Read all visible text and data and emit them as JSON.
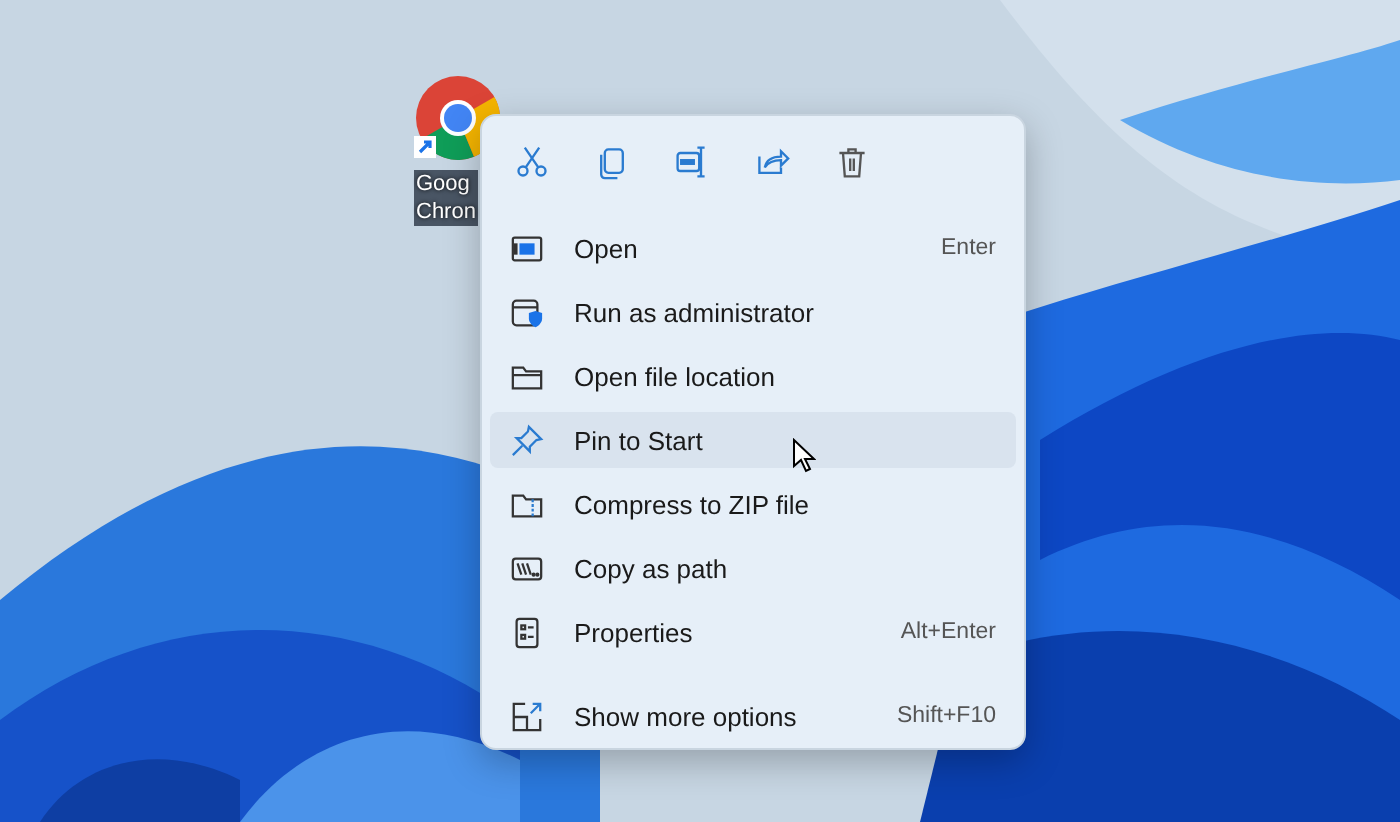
{
  "desktop_icon": {
    "label_lines": [
      "Goog",
      "Chron"
    ]
  },
  "context_menu": {
    "items": [
      {
        "label": "Open",
        "shortcut": "Enter",
        "selected": false
      },
      {
        "label": "Run as administrator",
        "selected": false
      },
      {
        "label": "Open file location",
        "selected": false
      },
      {
        "label": "Pin to Start",
        "selected": true
      },
      {
        "label": "Compress to ZIP file",
        "selected": false
      },
      {
        "label": "Copy as path",
        "selected": false
      },
      {
        "label": "Properties",
        "shortcut": "Alt+Enter",
        "selected": false
      }
    ],
    "footer_items": [
      {
        "label": "Show more options",
        "shortcut": "Shift+F10",
        "selected": false
      }
    ]
  }
}
